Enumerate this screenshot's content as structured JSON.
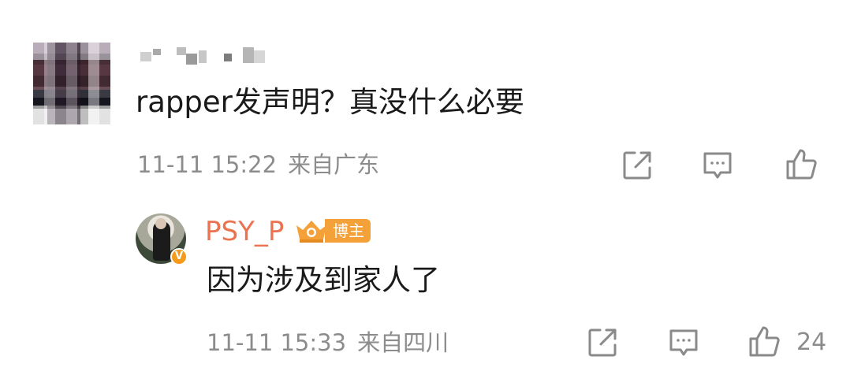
{
  "comment": {
    "text": "rapper发声明？真没什么必要",
    "time": "11-11 15:22",
    "location": "来自广东",
    "icons": {
      "share": "share-icon",
      "reply": "comment-icon",
      "like": "thumbs-up-icon"
    }
  },
  "reply": {
    "author": "PSY_P",
    "badge_label": "博主",
    "verified_mark": "V",
    "text": "因为涉及到家人了",
    "time": "11-11 15:33",
    "location": "来自四川",
    "like_count": "24",
    "icons": {
      "share": "share-icon",
      "reply": "comment-icon",
      "like": "thumbs-up-icon"
    }
  },
  "colors": {
    "author_accent": "#eb7350",
    "badge_orange": "#f4a13a",
    "meta_gray": "#8c8c8c",
    "icon_gray": "#8a8a8a"
  }
}
